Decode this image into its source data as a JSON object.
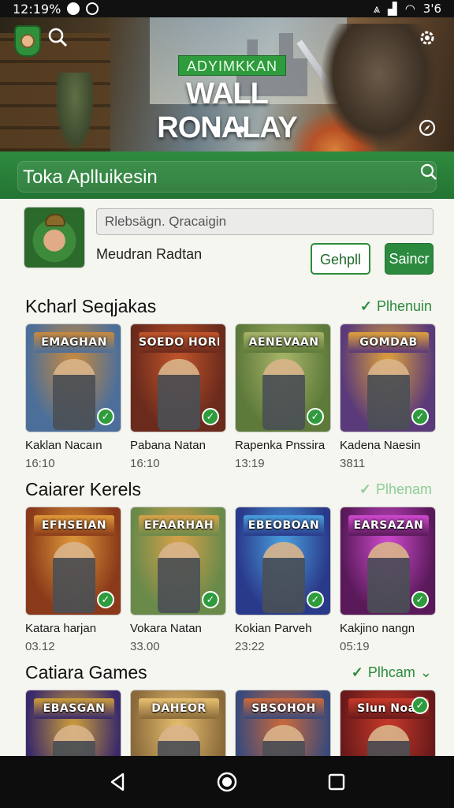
{
  "status_bar": {
    "time": "12:19%",
    "right_text": "3'6",
    "icons": [
      "circle-icon",
      "recording-icon",
      "vibrate-icon",
      "signal-icon",
      "wifi-icon",
      "battery-icon"
    ]
  },
  "hero": {
    "badge": "ADYIMKKAN",
    "title": "WALL RONALAY",
    "slides": 3,
    "active_slide": 1,
    "icons": [
      "app-logo-icon",
      "search-icon",
      "settings-gear-icon",
      "compass-icon"
    ]
  },
  "store_bar": {
    "title": "Toka Aplluikesin",
    "search_icon": "search-icon"
  },
  "profile": {
    "search_value": "Rlebsägn. Qracaigin",
    "search_placeholder": "Rlebsägn. Qracaigin",
    "name": "Meudran Radtan",
    "outline_button": "Gehpll",
    "solid_button": "Saincr"
  },
  "sections": [
    {
      "title": "Kcharl Seqjakas",
      "link": "Plhenuin",
      "link_faded": false,
      "cards": [
        {
          "banner": "EMAGHAN",
          "name": "Kaklan Nacaın",
          "meta": "16:10",
          "colors": [
            "#4c6f9a",
            "#c98a3c"
          ]
        },
        {
          "banner": "SOEDO HORRA",
          "name": "Pabana Natan",
          "meta": "16:10",
          "colors": [
            "#6a2a1c",
            "#c2552a"
          ]
        },
        {
          "banner": "AENEVAAN",
          "name": "Rapenka Pnssira",
          "meta": "13:19",
          "colors": [
            "#5e7a3a",
            "#a8b56a"
          ]
        },
        {
          "banner": "GOMDAB",
          "name": "Kadena Naesin",
          "meta": "3811",
          "colors": [
            "#5a3a7a",
            "#e0a23a"
          ]
        }
      ]
    },
    {
      "title": "Caiarer Kerels",
      "link": "Plhenam",
      "link_faded": true,
      "cards": [
        {
          "banner": "EFHSEIAN",
          "name": "Katara harjan",
          "meta": "03.12",
          "colors": [
            "#8a3a1a",
            "#e09a3a"
          ]
        },
        {
          "banner": "EFAARHAH",
          "name": "Vokara Natan",
          "meta": "33.00",
          "colors": [
            "#6a8a4a",
            "#d9a24a"
          ]
        },
        {
          "banner": "EBEOBOAN",
          "name": "Kokian Parveh",
          "meta": "23:22",
          "colors": [
            "#2a3a8a",
            "#4aa0e0"
          ]
        },
        {
          "banner": "EARSAZAN",
          "name": "Kakjino nangn",
          "meta": "05:19",
          "colors": [
            "#5a1a5a",
            "#d04ad0"
          ]
        }
      ]
    },
    {
      "title": "Catiara Games",
      "link": "Plhcam",
      "link_faded": false,
      "cards": [
        {
          "banner": "EBASGAN",
          "name": "",
          "meta": "",
          "colors": [
            "#3a2a6a",
            "#d0a03a"
          ]
        },
        {
          "banner": "DAHEOR",
          "name": "",
          "meta": "",
          "colors": [
            "#8a6a3a",
            "#e8c070"
          ]
        },
        {
          "banner": "SBSOHOH",
          "name": "",
          "meta": "",
          "colors": [
            "#3a4a7a",
            "#d06a3a"
          ]
        },
        {
          "banner": "Slun Noai",
          "name": "",
          "meta": "",
          "colors": [
            "#6a1a1a",
            "#c83a2a"
          ]
        }
      ]
    }
  ],
  "navbar": {
    "buttons": [
      "back-icon",
      "home-icon",
      "recents-icon"
    ]
  }
}
